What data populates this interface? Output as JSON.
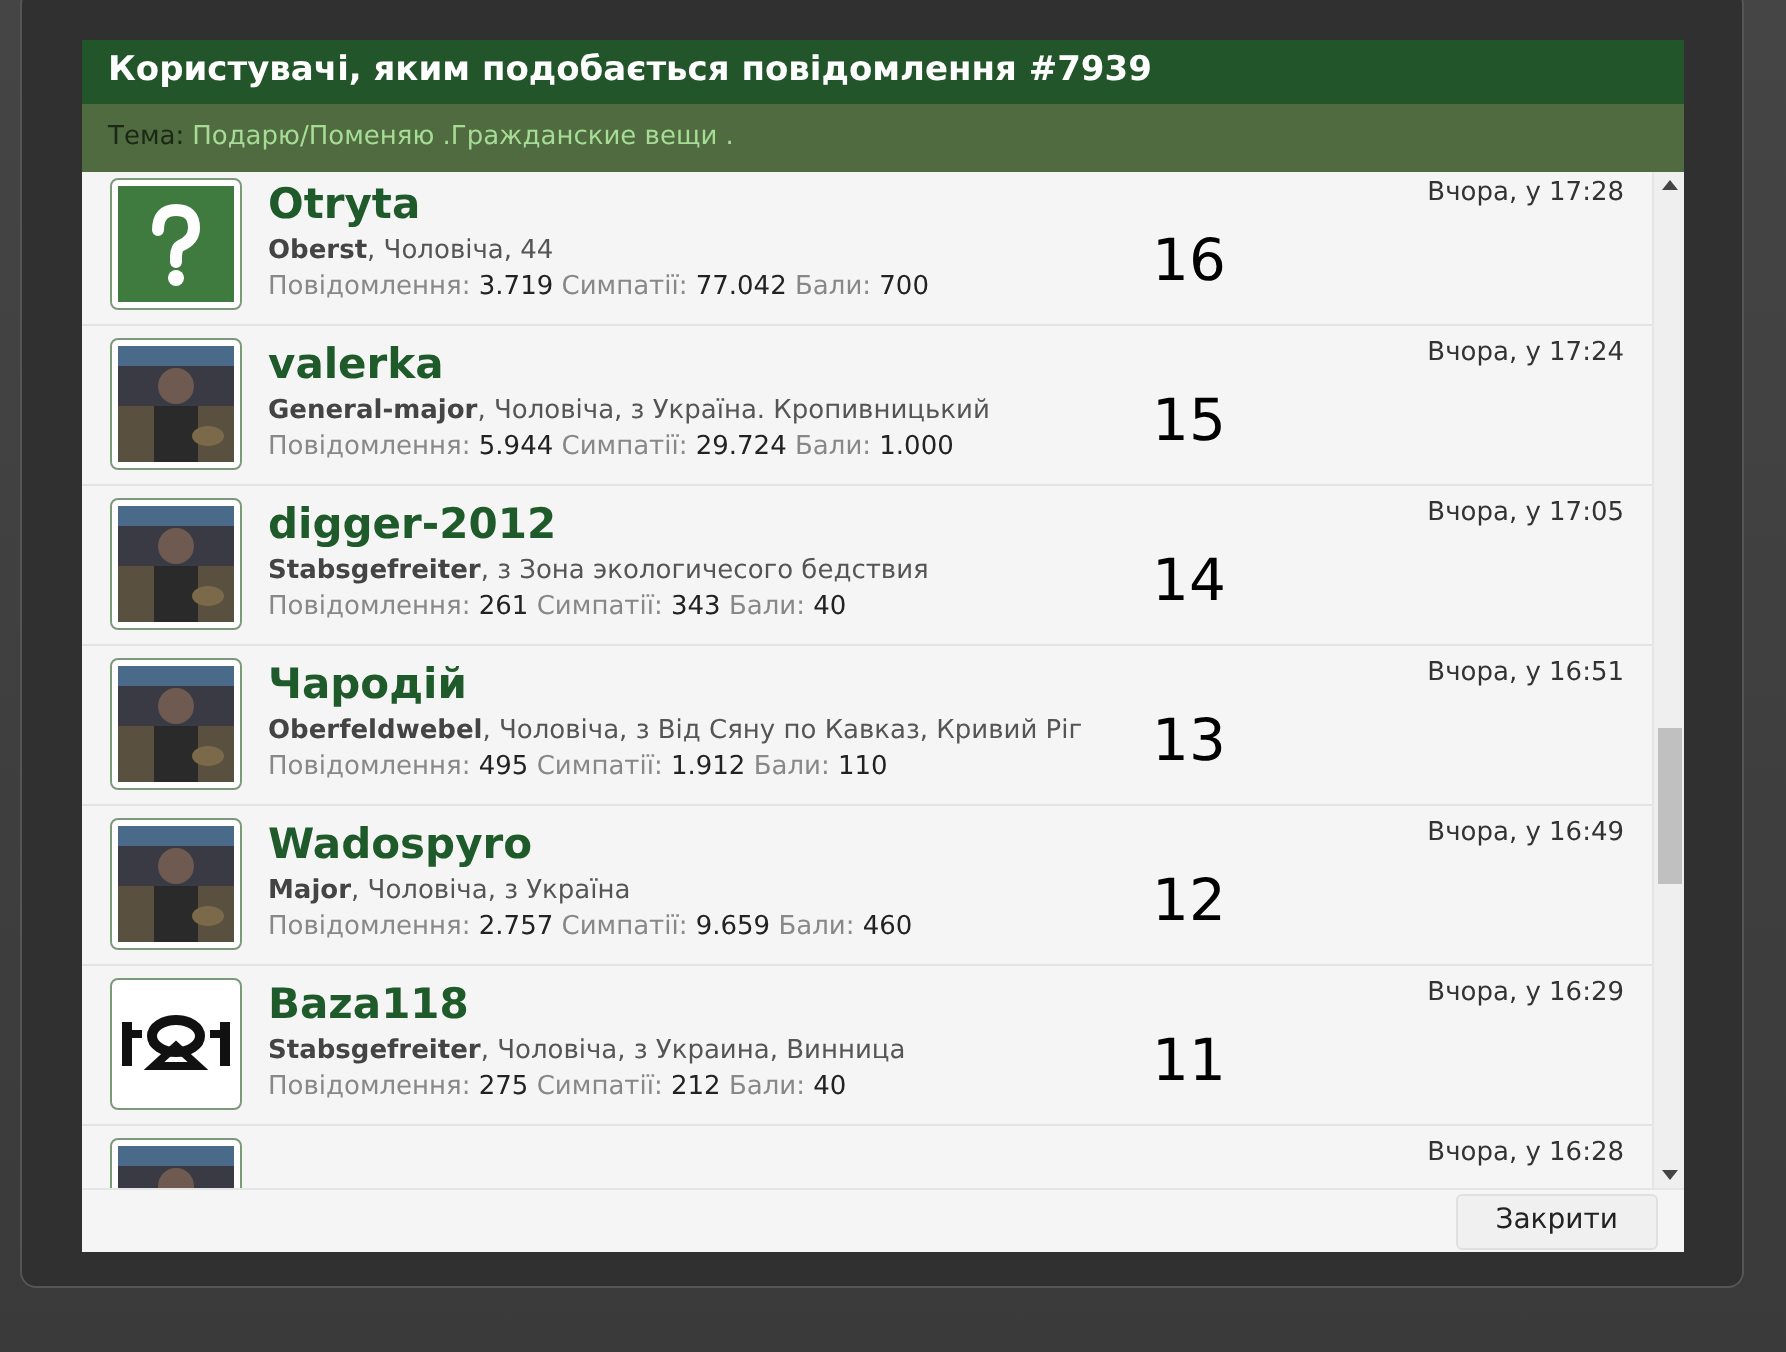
{
  "dialog": {
    "title": "Користувачі, яким подобається повідомлення #7939",
    "topic_label": "Тема:",
    "topic_link": "Подарю/Поменяю .Гражданские вещи .",
    "users": [
      {
        "name": "Otryta",
        "avatar": {
          "kind": "default"
        },
        "rank": "Oberst",
        "details": ", Чоловіча, 44",
        "stats": [
          {
            "label": "Повідомлення:",
            "value": "3.719"
          },
          {
            "label": "Симпатії:",
            "value": "77.042"
          },
          {
            "label": "Бали:",
            "value": "700"
          }
        ],
        "time": "Вчора, у 17:28",
        "annotation": "16"
      },
      {
        "name": "valerka",
        "rank": "General-major",
        "details": ", Чоловіча, з Україна. Кропивницький",
        "stats": [
          {
            "label": "Повідомлення:",
            "value": "5.944"
          },
          {
            "label": "Симпатії:",
            "value": "29.724"
          },
          {
            "label": "Бали:",
            "value": "1.000"
          }
        ],
        "time": "Вчора, у 17:24",
        "annotation": "15"
      },
      {
        "name": "digger-2012",
        "rank": "Stabsgefreiter",
        "details": ", з Зона экологичесого бедствия",
        "stats": [
          {
            "label": "Повідомлення:",
            "value": "261"
          },
          {
            "label": "Симпатії:",
            "value": "343"
          },
          {
            "label": "Бали:",
            "value": "40"
          }
        ],
        "time": "Вчора, у 17:05",
        "annotation": "14"
      },
      {
        "name": "Чародій",
        "rank": "Oberfeldwebel",
        "details": ", Чоловіча, з Від Сяну по Кавказ, Кривий Ріг",
        "stats": [
          {
            "label": "Повідомлення:",
            "value": "495"
          },
          {
            "label": "Симпатії:",
            "value": "1.912"
          },
          {
            "label": "Бали:",
            "value": "110"
          }
        ],
        "time": "Вчора, у 16:51",
        "annotation": "13"
      },
      {
        "name": "Wadospyro",
        "rank": "Major",
        "details": ", Чоловіча, з Україна",
        "stats": [
          {
            "label": "Повідомлення:",
            "value": "2.757"
          },
          {
            "label": "Симпатії:",
            "value": "9.659"
          },
          {
            "label": "Бали:",
            "value": "460"
          }
        ],
        "time": "Вчора, у 16:49",
        "annotation": "12"
      },
      {
        "name": "Baza118",
        "avatar": {
          "kind": "symbol"
        },
        "rank": "Stabsgefreiter",
        "details": ", Чоловіча, з Украина, Винница",
        "stats": [
          {
            "label": "Повідомлення:",
            "value": "275"
          },
          {
            "label": "Симпатії:",
            "value": "212"
          },
          {
            "label": "Бали:",
            "value": "40"
          }
        ],
        "time": "Вчора, у 16:29",
        "annotation": "11"
      },
      {
        "time": "Вчора, у 16:28"
      }
    ],
    "close_button": "Закрити"
  }
}
